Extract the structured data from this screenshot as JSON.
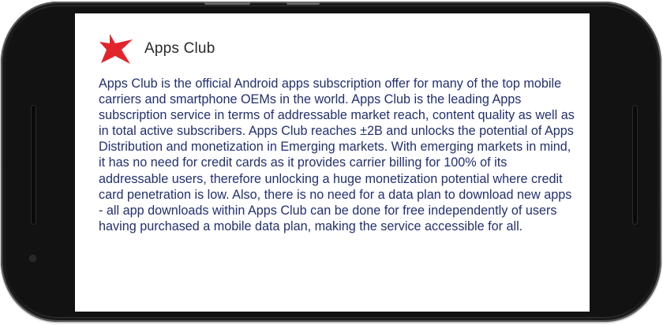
{
  "app": {
    "title": "Apps Club",
    "logo_icon": "red-star-icon",
    "accent_color": "#e2242b",
    "text_color": "#23306e",
    "description": "Apps Club is the official Android apps subscription offer for many of the top mobile carriers and smartphone OEMs in the world. Apps Club is the leading Apps subscription service in terms of addressable market reach, content quality as well as in total active subscribers. Apps Club reaches ±2B and unlocks the potential of Apps Distribution and monetization in Emerging markets. With emerging markets in mind, it has no need for credit cards as it provides carrier billing for 100% of its addressable users, therefore unlocking a huge monetization potential where credit card penetration is low. Also, there is no need for a data plan to download new apps - all app downloads within Apps Club can be done for free independently of users having purchased a mobile data plan, making the service accessible for all."
  },
  "device": {
    "frame_color": "#151515"
  }
}
